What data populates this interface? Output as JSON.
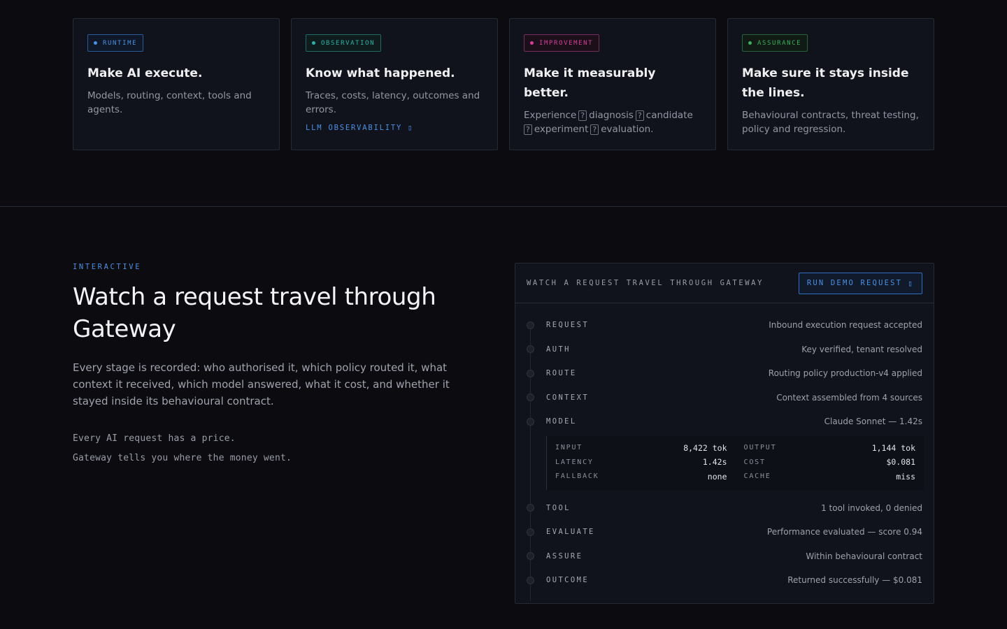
{
  "cards": [
    {
      "badge": "RUNTIME",
      "badge_color": "#4a90e2",
      "title": "Make AI execute.",
      "body": "Models, routing, context, tools and agents.",
      "link": ""
    },
    {
      "badge": "OBSERVATION",
      "badge_color": "#2bb3a8",
      "title": "Know what happened.",
      "body": "Traces, costs, latency, outcomes and errors.",
      "link": "LLM OBSERVABILITY ▯"
    },
    {
      "badge": "IMPROVEMENT",
      "badge_color": "#d63c9a",
      "title": "Make it measurably better.",
      "body_parts": [
        "Experience",
        "diagnosis",
        "candidate",
        "experiment",
        "evaluation."
      ],
      "link": ""
    },
    {
      "badge": "ASSURANCE",
      "badge_color": "#3fae5d",
      "title": "Make sure it stays inside the lines.",
      "body": "Behavioural contracts, threat testing, policy and regression.",
      "link": ""
    }
  ],
  "intro": {
    "eyebrow": "INTERACTIVE",
    "heading_line1": "Watch a request travel through",
    "heading_line2": "Gateway",
    "lede": "Every stage is recorded: who authorised it, which policy routed it, what context it received, which model answered, what it cost, and whether it stayed inside its behavioural contract.",
    "note1": "Every AI request has a price.",
    "note2": "Gateway tells you where the money went."
  },
  "panel": {
    "title": "WATCH A REQUEST TRAVEL THROUGH GATEWAY",
    "run_button": "RUN DEMO REQUEST",
    "run_icon": "▯",
    "steps_before": [
      {
        "label": "REQUEST",
        "detail": "Inbound execution request accepted"
      },
      {
        "label": "AUTH",
        "detail": "Key verified, tenant resolved"
      },
      {
        "label": "ROUTE",
        "detail": "Routing policy production-v4 applied"
      },
      {
        "label": "CONTEXT",
        "detail": "Context assembled from 4 sources"
      },
      {
        "label": "MODEL",
        "detail": "Claude Sonnet — 1.42s"
      }
    ],
    "metrics_left": [
      {
        "k": "INPUT",
        "v": "8,422 tok"
      },
      {
        "k": "LATENCY",
        "v": "1.42s"
      },
      {
        "k": "FALLBACK",
        "v": "none"
      }
    ],
    "metrics_right": [
      {
        "k": "OUTPUT",
        "v": "1,144 tok"
      },
      {
        "k": "COST",
        "v": "$0.081"
      },
      {
        "k": "CACHE",
        "v": "miss"
      }
    ],
    "steps_after": [
      {
        "label": "TOOL",
        "detail": "1 tool invoked, 0 denied"
      },
      {
        "label": "EVALUATE",
        "detail": "Performance evaluated — score 0.94"
      },
      {
        "label": "ASSURE",
        "detail": "Within behavioural contract"
      },
      {
        "label": "OUTCOME",
        "detail": "Returned successfully — $0.081"
      }
    ]
  }
}
